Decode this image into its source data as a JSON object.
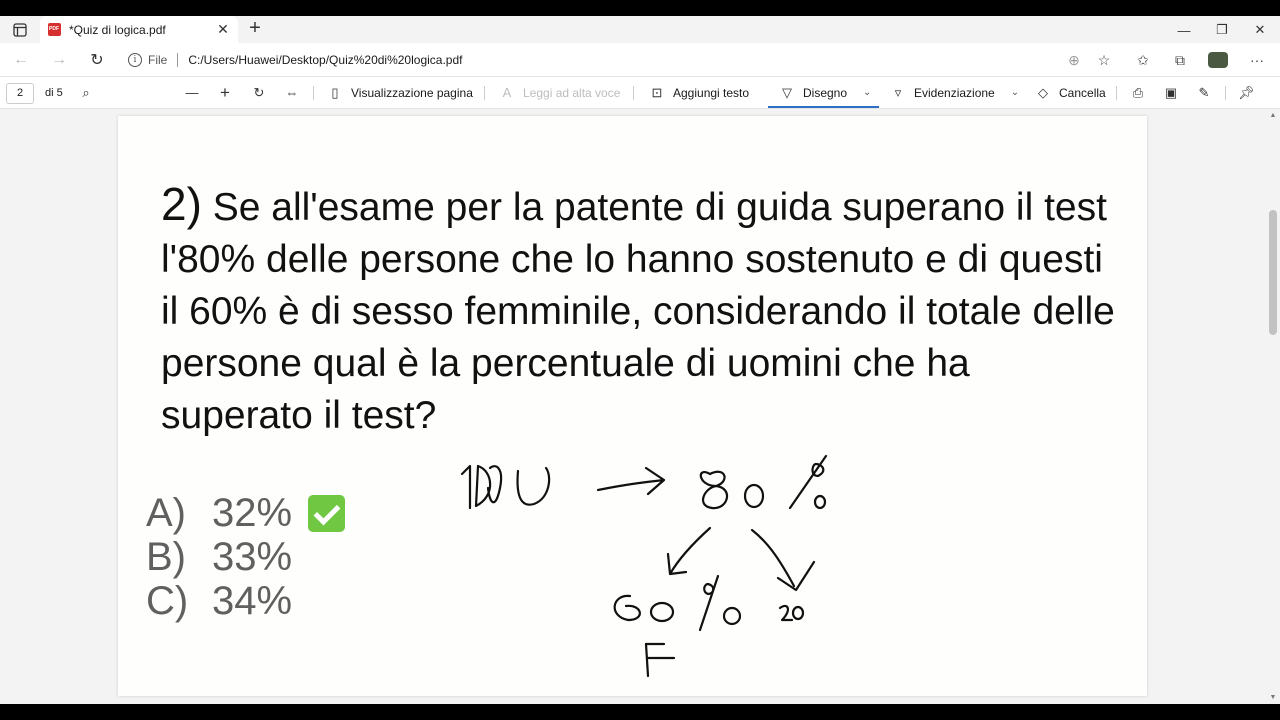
{
  "browser": {
    "tab_title": "*Quiz di logica.pdf",
    "tab_close": "✕",
    "new_tab": "+",
    "address_scheme": "File",
    "address_url": "C:/Users/Huawei/Desktop/Quiz%20di%20logica.pdf",
    "window_controls": [
      "—",
      "❐",
      "✕"
    ]
  },
  "pdf_toolbar": {
    "page_number": "2",
    "page_total": "di 5",
    "page_view": "Visualizzazione pagina",
    "read_aloud": "Leggi ad alta voce",
    "add_text": "Aggiungi testo",
    "draw": "Disegno",
    "highlight": "Evidenziazione",
    "erase": "Cancella"
  },
  "document": {
    "question_number": "2)",
    "question_text": " Se all'esame per la patente di guida superano il test l'80% delle persone che lo hanno sostenuto e di questi il 60% è di sesso femminile, considerando il totale delle persone qual è la percentuale di uomini che ha superato il test?",
    "answers": [
      {
        "letter": "A)",
        "value": "32%",
        "correct": true
      },
      {
        "letter": "B)",
        "value": "33%",
        "correct": false
      },
      {
        "letter": "C)",
        "value": "34%",
        "correct": false
      }
    ],
    "handwriting": [
      "100",
      "80%",
      "60%",
      "F"
    ]
  },
  "colors": {
    "accent": "#2f6ec6",
    "check": "#6fc742",
    "answer_text": "#606060"
  }
}
